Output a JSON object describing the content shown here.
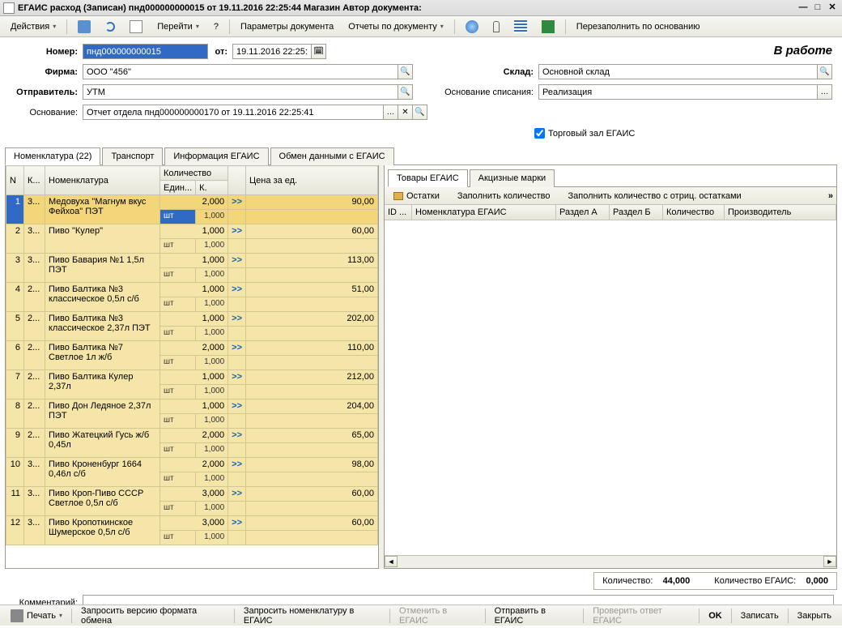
{
  "title": "ЕГАИС расход (Записан)  пнд000000000015 от 19.11.2016 22:25:44 Магазин Автор документа:",
  "toolbar": {
    "actions": "Действия",
    "goto": "Перейти",
    "params": "Параметры документа",
    "reports": "Отчеты по документу",
    "refill": "Перезаполнить по основанию"
  },
  "form": {
    "number_label": "Номер:",
    "number": "пнд000000000015",
    "from_label": "от:",
    "from": "19.11.2016 22:25:",
    "status": "В работе",
    "firm_label": "Фирма:",
    "firm": "ООО \"456\"",
    "warehouse_label": "Склад:",
    "warehouse": "Основной склад",
    "sender_label": "Отправитель:",
    "sender": "УТМ",
    "basis_wo_label": "Основание списания:",
    "basis_wo": "Реализация",
    "basis_label": "Основание:",
    "basis": "Отчет отдела пнд000000000170 от 19.11.2016 22:25:41",
    "hall_chk": "Торговый зал ЕГАИС"
  },
  "tabs": {
    "nomen": "Номенклатура (22)",
    "transport": "Транспорт",
    "info": "Информация ЕГАИС",
    "exchange": "Обмен данными с ЕГАИС"
  },
  "grid": {
    "h_n": "N",
    "h_k": "К...",
    "h_nom": "Номенклатура",
    "h_qty": "Количество",
    "h_unit": "Един...",
    "h_k2": "К.",
    "h_price": "Цена за ед.",
    "rows": [
      {
        "n": "1",
        "k": "3...",
        "name": "Медовуха \"Магнум вкус Фейхоа\" ПЭТ",
        "qty": "2,000",
        "unit": "шт",
        "k2": "1,000",
        "price": "90,00"
      },
      {
        "n": "2",
        "k": "3...",
        "name": "Пиво \"Кулер\"",
        "qty": "1,000",
        "unit": "шт",
        "k2": "1,000",
        "price": "60,00"
      },
      {
        "n": "3",
        "k": "3...",
        "name": "Пиво Бавария №1 1,5л ПЭТ",
        "qty": "1,000",
        "unit": "шт",
        "k2": "1,000",
        "price": "113,00"
      },
      {
        "n": "4",
        "k": "2...",
        "name": "Пиво Балтика №3 классическое 0,5л с/б",
        "qty": "1,000",
        "unit": "шт",
        "k2": "1,000",
        "price": "51,00"
      },
      {
        "n": "5",
        "k": "2...",
        "name": "Пиво Балтика №3 классическое 2,37л ПЭТ",
        "qty": "1,000",
        "unit": "шт",
        "k2": "1,000",
        "price": "202,00"
      },
      {
        "n": "6",
        "k": "2...",
        "name": "Пиво Балтика №7 Светлое 1л ж/б",
        "qty": "2,000",
        "unit": "шт",
        "k2": "1,000",
        "price": "110,00"
      },
      {
        "n": "7",
        "k": "2...",
        "name": "Пиво Балтика Кулер 2,37л",
        "qty": "1,000",
        "unit": "шт",
        "k2": "1,000",
        "price": "212,00"
      },
      {
        "n": "8",
        "k": "2...",
        "name": "Пиво Дон Ледяное 2,37л ПЭТ",
        "qty": "1,000",
        "unit": "шт",
        "k2": "1,000",
        "price": "204,00"
      },
      {
        "n": "9",
        "k": "2...",
        "name": "Пиво Жатецкий Гусь ж/б 0,45л",
        "qty": "2,000",
        "unit": "шт",
        "k2": "1,000",
        "price": "65,00"
      },
      {
        "n": "10",
        "k": "3...",
        "name": "Пиво Кроненбург 1664 0,46л с/б",
        "qty": "2,000",
        "unit": "шт",
        "k2": "1,000",
        "price": "98,00"
      },
      {
        "n": "11",
        "k": "3...",
        "name": "Пиво Кроп-Пиво СССР Светлое 0,5л с/б",
        "qty": "3,000",
        "unit": "шт",
        "k2": "1,000",
        "price": "60,00"
      },
      {
        "n": "12",
        "k": "3...",
        "name": "Пиво Кропоткинское Шумерское 0,5л с/б",
        "qty": "3,000",
        "unit": "шт",
        "k2": "1,000",
        "price": "60,00"
      }
    ]
  },
  "right": {
    "tab_goods": "Товары ЕГАИС",
    "tab_marks": "Акцизные марки",
    "btn_rest": "Остатки",
    "btn_fill": "Заполнить количество",
    "btn_fill_neg": "Заполнить количество с отриц. остатками",
    "h_id": "ID ...",
    "h_nom": "Номенклатура ЕГАИС",
    "h_sa": "Раздел А",
    "h_sb": "Раздел Б",
    "h_qty": "Количество",
    "h_prod": "Производитель"
  },
  "totals": {
    "qty_label": "Количество:",
    "qty": "44,000",
    "eqty_label": "Количество ЕГАИС:",
    "eqty": "0,000"
  },
  "comment_label": "Комментарий:",
  "bottom": {
    "print": "Печать",
    "req_ver": "Запросить версию формата обмена",
    "req_nom": "Запросить номенклатуру в ЕГАИС",
    "cancel_e": "Отменить в ЕГАИС",
    "send_e": "Отправить в ЕГАИС",
    "check_e": "Проверить ответ ЕГАИС",
    "ok": "OK",
    "save": "Записать",
    "close": "Закрыть"
  }
}
